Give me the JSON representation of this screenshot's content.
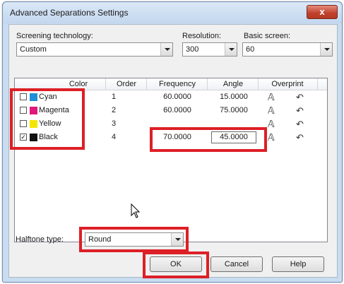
{
  "window": {
    "title": "Advanced Separations Settings",
    "close_label": "x"
  },
  "screening": {
    "label": "Screening technology:",
    "value": "Custom"
  },
  "resolution": {
    "label": "Resolution:",
    "value": "300"
  },
  "basic_screen": {
    "label": "Basic screen:",
    "value": "60"
  },
  "table": {
    "headers": [
      "Color",
      "Order",
      "Frequency",
      "Angle",
      "Overprint"
    ],
    "rows": [
      {
        "color": "Cyan",
        "swatch": "#1f8fd6",
        "checked": false,
        "order": "1",
        "frequency": "60.0000",
        "angle": "15.0000"
      },
      {
        "color": "Magenta",
        "swatch": "#e0197d",
        "checked": false,
        "order": "2",
        "frequency": "60.0000",
        "angle": "75.0000"
      },
      {
        "color": "Yellow",
        "swatch": "#f2e600",
        "checked": false,
        "order": "3",
        "frequency": "",
        "angle": ""
      },
      {
        "color": "Black",
        "swatch": "#111111",
        "checked": true,
        "order": "4",
        "frequency": "70.0000",
        "angle": "45.0000"
      }
    ]
  },
  "halftone": {
    "label": "Halftone type:",
    "value": "Round"
  },
  "buttons": {
    "ok": "OK",
    "cancel": "Cancel",
    "help": "Help"
  },
  "icons": {
    "overprint_text": "overprint-text-icon",
    "overprint_graphic": "overprint-graphic-icon",
    "pointer": "mouse-pointer-icon"
  },
  "colors": {
    "highlight": "#dd1f26"
  }
}
